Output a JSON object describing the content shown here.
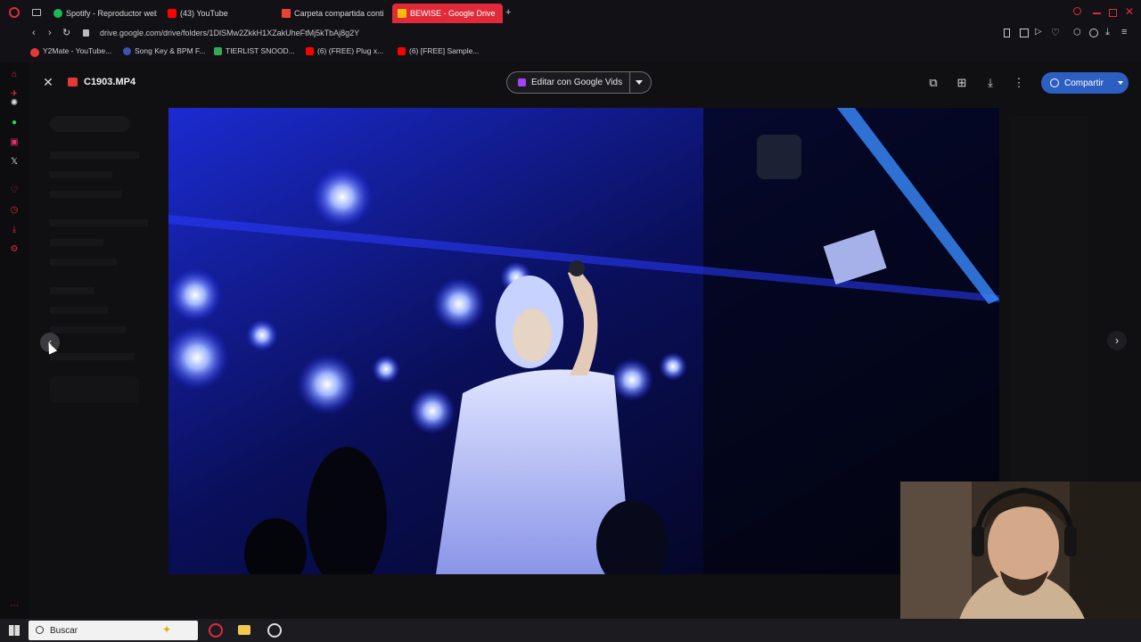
{
  "browser": {
    "tabs": [
      {
        "label": "Spotify - Reproductor web",
        "color": "#1db954"
      },
      {
        "label": "(43) YouTube",
        "color": "#ff0000"
      },
      {
        "label": "Carpeta compartida conti",
        "color": "#ea4335"
      },
      {
        "label": "BEWISE - Google Drive",
        "color": "#fbbc04"
      }
    ],
    "url": "drive.google.com/drive/folders/1DlSMw2ZkkH1XZakUheFtMj5kTbAj8g2Y",
    "bookmarks": [
      {
        "label": "Y2Mate - YouTube...",
        "color": "#e53935"
      },
      {
        "label": "Song Key & BPM F...",
        "color": "#3f51b5"
      },
      {
        "label": "TIERLIST SNOOD...",
        "color": "#34a853"
      },
      {
        "label": "(6) (FREE) Plug x...",
        "color": "#ff0000"
      },
      {
        "label": "(6) [FREE] Sample...",
        "color": "#ff0000"
      }
    ]
  },
  "viewer": {
    "file_name": "C1903.MP4",
    "edit_label": "Editar con Google Vids",
    "share_label": "Compartir",
    "icons": {
      "close": "close-icon",
      "file_type": "video-file-icon",
      "add_to_folder": "add-to-folder-icon",
      "comment": "add-comment-icon",
      "download": "download-icon",
      "more": "more-vert-icon",
      "prev": "chevron-left-icon",
      "next": "chevron-right-icon"
    }
  },
  "taskbar": {
    "search_placeholder": "Buscar"
  },
  "colors": {
    "accent": "#2d5fc2",
    "opera_red": "#e02a3a",
    "stage_blue": "#2a3cff"
  }
}
